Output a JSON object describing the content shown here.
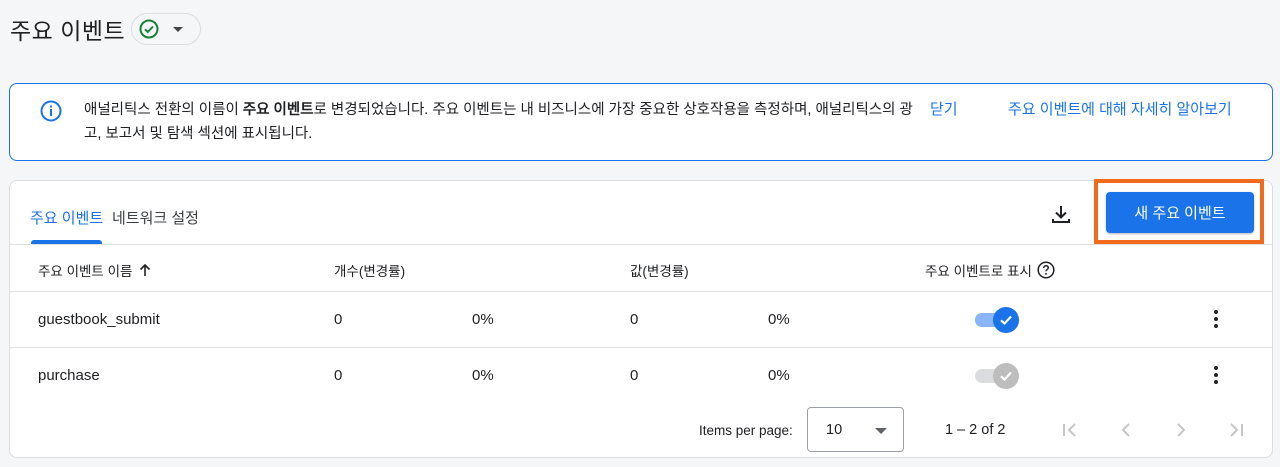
{
  "header": {
    "title": "주요 이벤트"
  },
  "banner": {
    "text_before": "애널리틱스 전환의 이름이 ",
    "text_bold": "주요 이벤트",
    "text_after": "로 변경되었습니다. 주요 이벤트는 내 비즈니스에 가장 중요한 상호작용을 측정하며, 애널리틱스의 광고, 보고서 및 탐색 섹션에 표시됩니다.",
    "close_label": "닫기",
    "learn_more_label": "주요 이벤트에 대해 자세히 알아보기"
  },
  "tabs": [
    {
      "label": "주요 이벤트",
      "active": true
    },
    {
      "label": "네트워크 설정",
      "active": false
    }
  ],
  "new_button_label": "새 주요 이벤트",
  "table": {
    "columns": {
      "name": "주요 이벤트 이름",
      "count": "개수(변경률)",
      "value": "값(변경률)",
      "mark": "주요 이벤트로 표시"
    },
    "rows": [
      {
        "name": "guestbook_submit",
        "count": "0",
        "count_change": "0%",
        "value": "0",
        "value_change": "0%",
        "marked": true
      },
      {
        "name": "purchase",
        "count": "0",
        "count_change": "0%",
        "value": "0",
        "value_change": "0%",
        "marked": false
      }
    ]
  },
  "pagination": {
    "items_per_page_label": "Items per page:",
    "page_size": "10",
    "range": "1 – 2 of 2"
  },
  "colors": {
    "accent": "#1a73e8",
    "highlight_frame": "#f26a1b",
    "success": "#188038"
  }
}
